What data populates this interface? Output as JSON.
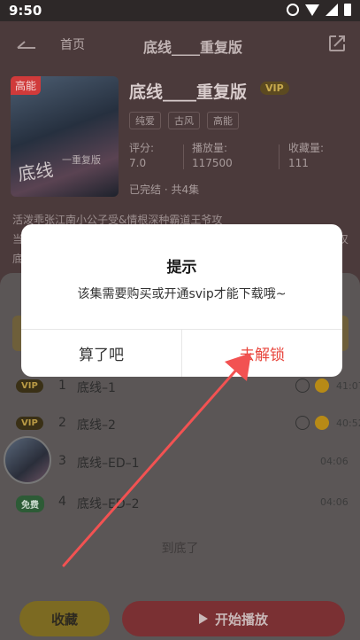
{
  "status_bar": {
    "time": "9:50"
  },
  "nav": {
    "home_label": "首页",
    "title": "底线____重复版"
  },
  "drama": {
    "badge": "高能",
    "cover_text": "底线",
    "cover_sub": "一重复版",
    "title": "底线____重复版",
    "vip_label": "VIP",
    "tags": [
      "纯爱",
      "古风",
      "高能"
    ],
    "stats": [
      {
        "label": "评分:",
        "value": "7.0"
      },
      {
        "label": "播放量:",
        "value": "117500"
      },
      {
        "label": "收藏量:",
        "value": "111"
      }
    ],
    "status": "已完结 · 共4集",
    "description_line1": "活泼乖张江南小公子受&情根深种霸道王爷攻",
    "description_line2": "当",
    "description_line2_end": "叹",
    "description_line3": "底"
  },
  "episodes": [
    {
      "badge": "VIP",
      "badge_type": "vip",
      "num": "1",
      "name": "底线–1",
      "duration": "41:07",
      "locked": true
    },
    {
      "badge": "VIP",
      "badge_type": "vip",
      "num": "2",
      "name": "底线–2",
      "duration": "40:52",
      "locked": true
    },
    {
      "badge": "",
      "badge_type": "none",
      "num": "3",
      "name": "底线–ED–1",
      "duration": "04:06",
      "locked": false
    },
    {
      "badge": "免费",
      "badge_type": "free",
      "num": "4",
      "name": "底线–ED–2",
      "duration": "04:06",
      "locked": false
    }
  ],
  "list_end_text": "到底了",
  "buttons": {
    "favorite": "收藏",
    "play": "开始播放"
  },
  "dialog": {
    "title": "提示",
    "message": "该集需要购买或开通svip才能下载哦~",
    "cancel": "算了吧",
    "confirm": "去解锁"
  },
  "colors": {
    "accent": "#e8453c",
    "vip_gold": "#b99a45",
    "annotation_arrow": "#f25252"
  }
}
